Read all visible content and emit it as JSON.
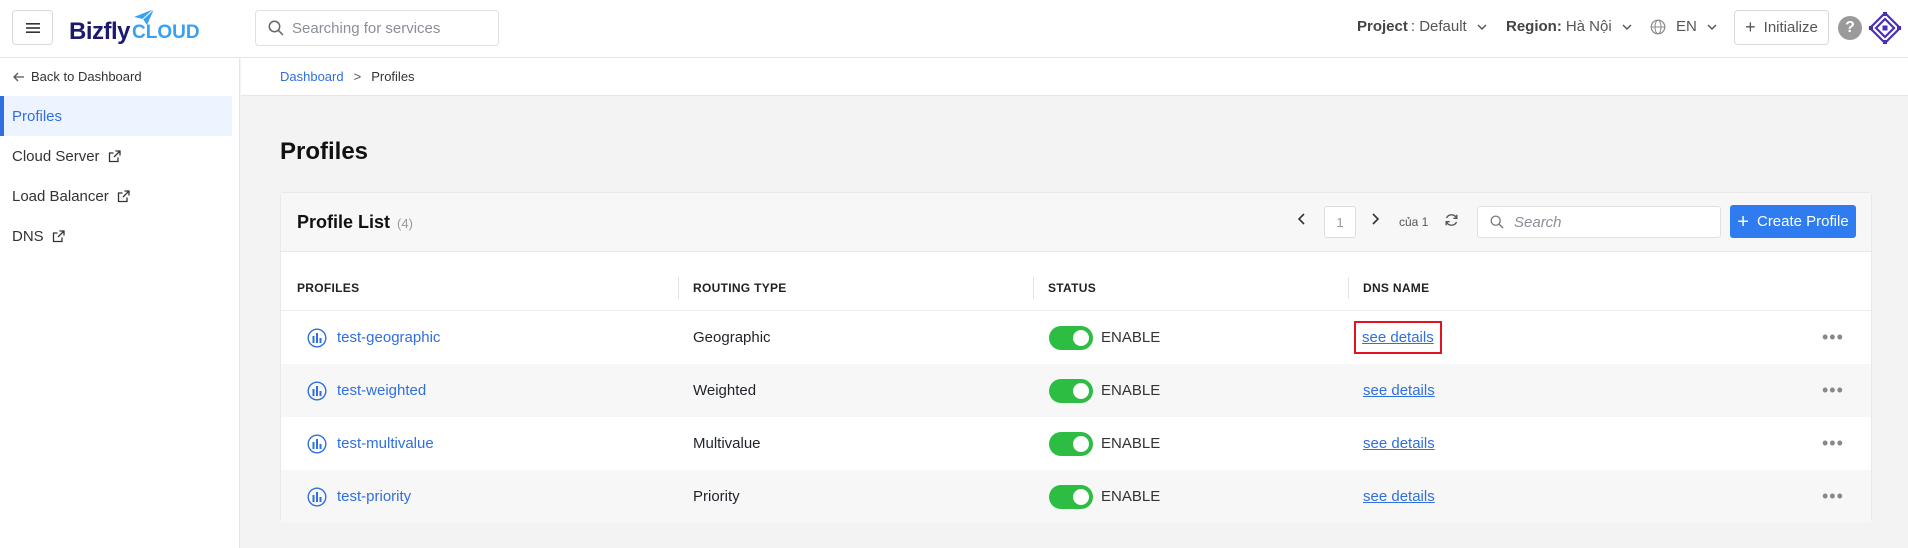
{
  "header": {
    "logo_main": "Bizfly",
    "logo_sub": "CLOUD",
    "search_placeholder": "Searching for services",
    "project_label": "Project",
    "project_value": ": Default",
    "region_label": "Region:",
    "region_value": "Hà Nội",
    "language": "EN",
    "initialize_label": "Initialize",
    "help_label": "?"
  },
  "sidebar": {
    "back_label": "Back to Dashboard",
    "items": [
      {
        "label": "Profiles",
        "active": true,
        "external": false
      },
      {
        "label": "Cloud Server",
        "active": false,
        "external": true
      },
      {
        "label": "Load Balancer",
        "active": false,
        "external": true
      },
      {
        "label": "DNS",
        "active": false,
        "external": true
      }
    ]
  },
  "breadcrumb": {
    "parent": "Dashboard",
    "separator": ">",
    "current": "Profiles"
  },
  "page": {
    "title": "Profiles"
  },
  "card": {
    "title": "Profile List",
    "count": "(4)",
    "page_number": "1",
    "page_of": "của 1",
    "search_placeholder": "Search",
    "create_label": "Create Profile"
  },
  "table": {
    "headers": [
      "PROFILES",
      "ROUTING TYPE",
      "STATUS",
      "DNS NAME"
    ],
    "rows": [
      {
        "profile": "test-geographic",
        "routing": "Geographic",
        "status": "ENABLE",
        "dns": "see details",
        "more": "•••"
      },
      {
        "profile": "test-weighted",
        "routing": "Weighted",
        "status": "ENABLE",
        "dns": "see details",
        "more": "•••"
      },
      {
        "profile": "test-multivalue",
        "routing": "Multivalue",
        "status": "ENABLE",
        "dns": "see details",
        "more": "•••"
      },
      {
        "profile": "test-priority",
        "routing": "Priority",
        "status": "ENABLE",
        "dns": "see details",
        "more": "•••"
      }
    ]
  },
  "colors": {
    "primary": "#2f7bf0",
    "link": "#2f6fe0",
    "toggle_on": "#2ebd43",
    "highlight": "#e0141e"
  }
}
